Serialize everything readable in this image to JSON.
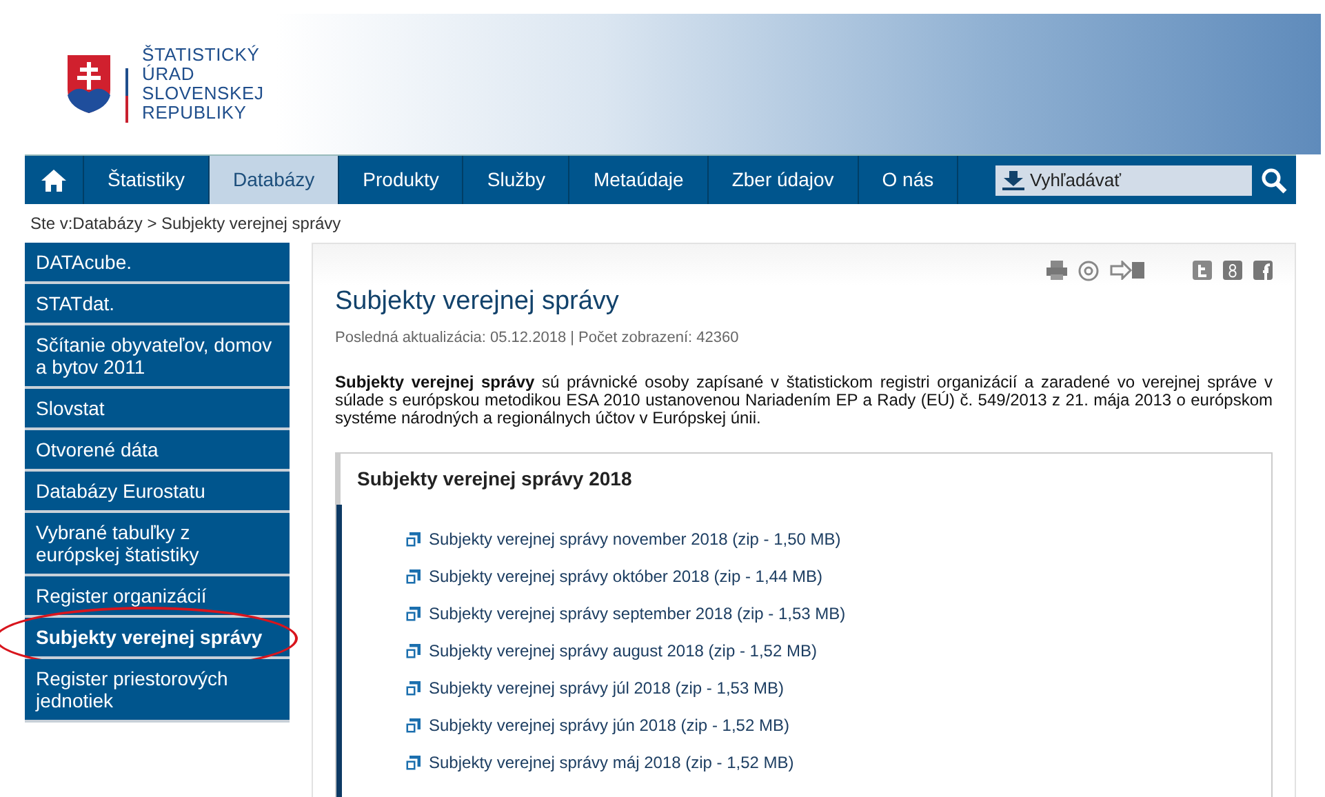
{
  "logo": {
    "lines": [
      "ŠTATISTICKÝ",
      "ÚRAD",
      "SLOVENSKEJ",
      "REPUBLIKY"
    ]
  },
  "nav": {
    "tabs": [
      {
        "kind": "home",
        "selected": false
      },
      {
        "kind": "text",
        "label": "Štatistiky",
        "selected": false
      },
      {
        "kind": "text",
        "label": "Databázy",
        "selected": true
      },
      {
        "kind": "text",
        "label": "Produkty",
        "selected": false
      },
      {
        "kind": "text",
        "label": "Služby",
        "selected": false
      },
      {
        "kind": "text",
        "label": "Metaúdaje",
        "selected": false
      },
      {
        "kind": "text",
        "label": "Zber údajov",
        "selected": false
      },
      {
        "kind": "text",
        "label": "O nás",
        "selected": false
      }
    ],
    "search": {
      "placeholder": "Vyhľadávať"
    }
  },
  "breadcrumb": "Ste v:Databázy > Subjekty verejnej správy",
  "sidebar": {
    "items": [
      {
        "label": "DATAcube.",
        "selected": false,
        "circled": false
      },
      {
        "label": "STATdat.",
        "selected": false,
        "circled": false
      },
      {
        "label": "Sčítanie obyvateľov, domov a bytov 2011",
        "selected": false,
        "circled": false
      },
      {
        "label": "Slovstat",
        "selected": false,
        "circled": false
      },
      {
        "label": "Otvorené dáta",
        "selected": false,
        "circled": false
      },
      {
        "label": "Databázy Eurostatu",
        "selected": false,
        "circled": false
      },
      {
        "label": "Vybrané tabuľky z európskej štatistiky",
        "selected": false,
        "circled": false
      },
      {
        "label": "Register organizácií",
        "selected": false,
        "circled": false
      },
      {
        "label": "Subjekty verejnej správy",
        "selected": true,
        "circled": true
      },
      {
        "label": "Register priestorových jednotiek",
        "selected": false,
        "circled": false
      }
    ]
  },
  "article": {
    "title": "Subjekty verejnej správy",
    "meta": "Posledná aktualizácia: 05.12.2018 | Počet zobrazení: 42360",
    "intro": "**Subjekty  verejnej správy** sú právnické osoby zapísané v štatistickom registri organizácií a zaradené vo verejnej správe v súlade s európskou metodikou  ESA 2010 ustanovenou  Nariadením EP a Rady (EÚ) č. 549/2013 z 21. mája 2013 o európskom systéme národných a regionálnych účtov v Európskej únii.",
    "section": {
      "title": "Subjekty verejnej správy 2018",
      "files": [
        "Subjekty verejnej správy november 2018 (zip - 1,50 MB)",
        "Subjekty verejnej správy október 2018 (zip - 1,44 MB)",
        "Subjekty verejnej správy september 2018 (zip - 1,53 MB)",
        "Subjekty verejnej správy august 2018 (zip - 1,52 MB)",
        "Subjekty verejnej správy júl 2018 (zip - 1,53 MB)",
        "Subjekty verejnej správy jún 2018 (zip - 1,52 MB)",
        "Subjekty verejnej správy máj 2018 (zip - 1,52 MB)"
      ]
    }
  }
}
